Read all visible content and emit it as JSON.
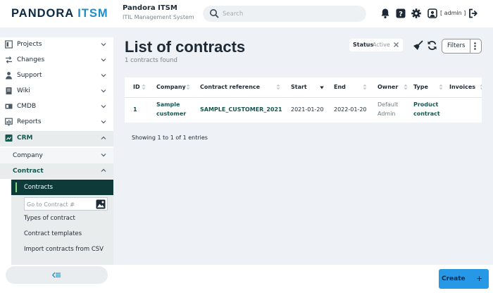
{
  "header": {
    "logo_main": "PANDORA",
    "logo_accent": "ITSM",
    "app_name": "Pandora ITSM",
    "app_subtitle": "ITIL Management System",
    "search_placeholder": "Search",
    "user_label": "[ admin ]"
  },
  "sidebar": {
    "items": [
      {
        "label": "Projects"
      },
      {
        "label": "Changes"
      },
      {
        "label": "Support"
      },
      {
        "label": "Wiki"
      },
      {
        "label": "CMDB"
      },
      {
        "label": "Reports"
      },
      {
        "label": "CRM"
      }
    ],
    "crm_sub": [
      {
        "label": "Company"
      },
      {
        "label": "Contract"
      }
    ],
    "contract_sub": {
      "active": "Contracts",
      "goto_placeholder": "Go to Contract #",
      "items": [
        {
          "label": "Types of contract"
        },
        {
          "label": "Contract templates"
        },
        {
          "label": "Import contracts from CSV"
        }
      ]
    }
  },
  "main": {
    "title": "List of contracts",
    "count_text": "1 contracts found",
    "status_filter": {
      "key": "Status",
      "value": "Active"
    },
    "filters_label": "Filters",
    "columns": [
      "ID",
      "Company",
      "Contract reference",
      "Start",
      "End",
      "Owner",
      "Type",
      "Invoices"
    ],
    "rows": [
      {
        "id": "1",
        "company_line1": "Sample",
        "company_line2": "customer",
        "reference": "SAMPLE_CUSTOMER_2021",
        "start": "2021-01-20",
        "end": "2022-01-20",
        "owner_line1": "Default",
        "owner_line2": "Admin",
        "type_line1": "Product",
        "type_line2": "contract",
        "invoices": ""
      }
    ],
    "showing_text": "Showing 1 to 1 of 1 entries",
    "create_label": "Create",
    "create_plus": "+"
  },
  "colors": {
    "brand_dark": "#0b2a45",
    "brand_accent": "#1f8ec7",
    "active_bg": "#0f3a3a",
    "active_marker": "#7ee07a",
    "link_green": "#14574e",
    "create_blue": "#2798e6"
  },
  "icons": {
    "search": "search-icon",
    "bell": "bell-icon",
    "help": "help-icon",
    "settings": "gear-icon",
    "user": "user-icon",
    "logout": "logout-icon",
    "broom": "broom-icon",
    "refresh": "refresh-icon",
    "menu": "vertical-dots-icon",
    "collapse": "collapse-sidebar-icon"
  }
}
